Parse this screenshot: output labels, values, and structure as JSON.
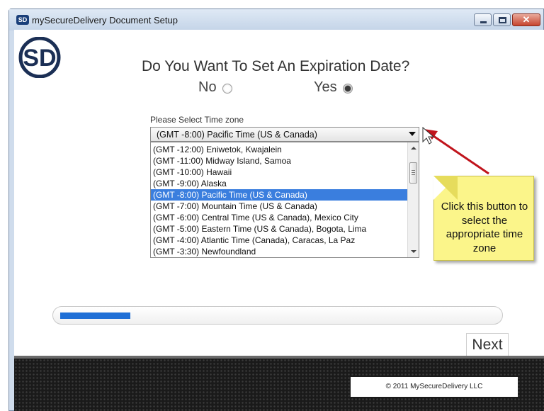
{
  "window": {
    "title": "mySecureDelivery Document Setup",
    "icon_text": "SD",
    "controls": [
      "minimize-icon",
      "maximize-icon",
      "close-icon"
    ],
    "close_glyph": "✕"
  },
  "logo": {
    "text": "SD",
    "color": "#1b2f55"
  },
  "main": {
    "question": "Do You Want To Set An Expiration Date?",
    "option_no": "No",
    "option_yes": "Yes",
    "selected_option": "Yes"
  },
  "timezone": {
    "label": "Please Select Time zone",
    "selected": "(GMT -8:00) Pacific Time (US & Canada)",
    "options": [
      "(GMT -12:00) Eniwetok, Kwajalein",
      "(GMT -11:00) Midway Island, Samoa",
      "(GMT -10:00) Hawaii",
      "(GMT -9:00) Alaska",
      "(GMT -8:00) Pacific Time (US & Canada)",
      "(GMT -7:00) Mountain Time (US & Canada)",
      "(GMT -6:00) Central Time (US & Canada), Mexico City",
      "(GMT -5:00) Eastern Time (US & Canada), Bogota, Lima",
      "(GMT -4:00) Atlantic Time (Canada), Caracas, La Paz",
      "(GMT -3:30) Newfoundland"
    ],
    "highlight_color": "#3a7ede"
  },
  "callout": {
    "text": "Click this button to select the appropriate time zone"
  },
  "progress": {
    "fraction": 0.16,
    "color": "#1f6fd6"
  },
  "actions": {
    "next_label": "Next"
  },
  "footer": {
    "copyright": "© 2011 MySecureDelivery LLC"
  }
}
